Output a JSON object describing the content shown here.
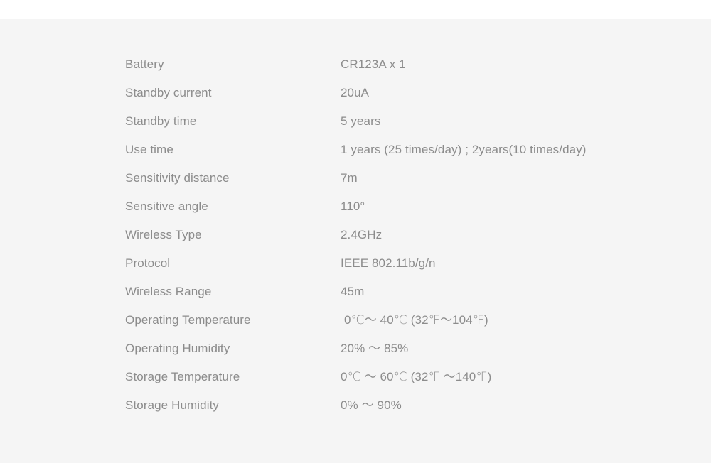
{
  "page": {
    "background_color": "#ffffff",
    "panel_color": "#f5f5f5",
    "text_color": "#8c8c8c"
  },
  "spec_table": {
    "rows": [
      {
        "label": "Battery",
        "value": "CR123A x 1"
      },
      {
        "label": "Standby current",
        "value": "20uA"
      },
      {
        "label": "Standby time",
        "value": "5 years"
      },
      {
        "label": "Use time",
        "value": "1 years (25 times/day) ; 2years(10 times/day)"
      },
      {
        "label": "Sensitivity distance",
        "value": "7m"
      },
      {
        "label": "Sensitive angle",
        "value": "110°"
      },
      {
        "label": "Wireless Type",
        "value": "2.4GHz"
      },
      {
        "label": "Protocol",
        "value": "IEEE 802.11b/g/n"
      },
      {
        "label": "Wireless Range",
        "value": "45m"
      },
      {
        "label": "Operating Temperature",
        "value": "0℃〜 40℃  (32℉〜104℉)",
        "indent": true
      },
      {
        "label": "Operating Humidity",
        "value": "20% ～ 85%"
      },
      {
        "label": "Storage Temperature",
        "value": "0℃ ～ 60℃ (32℉ ～140℉)"
      },
      {
        "label": "Storage Humidity",
        "value": "0% ～ 90%"
      }
    ]
  }
}
